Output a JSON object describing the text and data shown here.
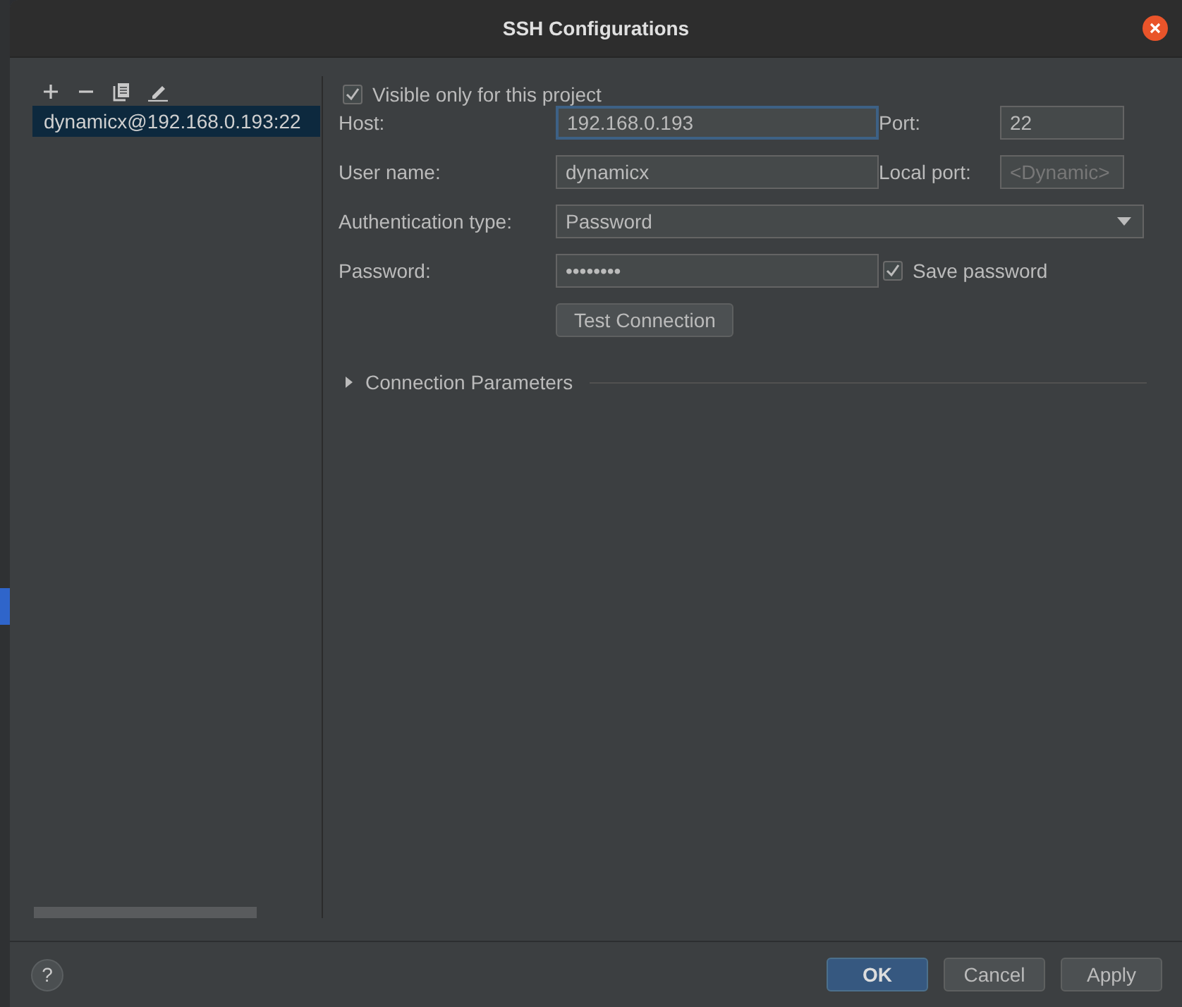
{
  "window": {
    "title": "SSH Configurations"
  },
  "configurations": [
    {
      "name": "dynamicx@192.168.0.193:22",
      "selected": true
    }
  ],
  "visible_only": {
    "label": "Visible only for this project",
    "checked": true
  },
  "host": {
    "label": "Host:",
    "value": "192.168.0.193",
    "focused": true
  },
  "port": {
    "label": "Port:",
    "value": "22"
  },
  "user_name": {
    "label": "User name:",
    "value": "dynamicx"
  },
  "local_port": {
    "label": "Local port:",
    "placeholder": "<Dynamic>"
  },
  "auth_type": {
    "label": "Authentication type:",
    "value": "Password"
  },
  "password": {
    "label": "Password:",
    "value": "••••••••"
  },
  "save_password": {
    "label": "Save password",
    "checked": true
  },
  "test_button": "Test Connection",
  "connection_parameters": {
    "label": "Connection Parameters",
    "expanded": false
  },
  "help": "?",
  "buttons": [
    {
      "label": "OK",
      "default": true
    },
    {
      "label": "Cancel",
      "default": false
    },
    {
      "label": "Apply",
      "default": false
    }
  ]
}
